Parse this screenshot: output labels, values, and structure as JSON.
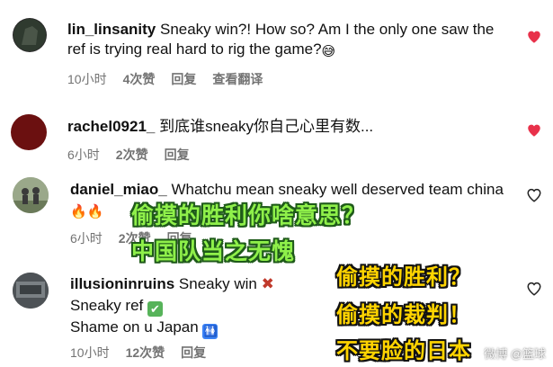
{
  "comments": [
    {
      "username": "lin_linsanity",
      "text_lines": [
        "Sneaky win?! How so? Am I the only one saw the",
        "ref is trying real hard to rig the game?"
      ],
      "time": "10小时",
      "likes": "4次赞",
      "reply": "回复",
      "translate": "查看翻译",
      "liked": true
    },
    {
      "username": "rachel0921_",
      "text_lines": [
        "到底谁sneaky你自己心里有数..."
      ],
      "time": "6小时",
      "likes": "2次赞",
      "reply": "回复",
      "liked": true
    },
    {
      "username": "daniel_miao_",
      "text_lines": [
        "Whatchu mean sneaky well deserved team china",
        ""
      ],
      "time": "6小时",
      "likes": "2次赞",
      "reply": "回复",
      "liked": false
    },
    {
      "username": "illusioninruins",
      "text_lines": [
        "Sneaky win",
        "Sneaky ref",
        "Shame on u Japan"
      ],
      "time": "10小时",
      "likes": "12次赞",
      "reply": "回复",
      "liked": false
    }
  ],
  "overlays": {
    "green_line1": "偷摸的胜利你啥意思？",
    "green_line2": "中国队当之无愧",
    "yellow_line1": "偷摸的胜利？",
    "yellow_line2": "偷摸的裁判！",
    "yellow_line3": "不要脸的日本"
  },
  "watermark": "微博 @篮球",
  "colors": {
    "heart_liked": "#e8314a",
    "meta_gray": "#737373",
    "overlay_green": "#8ff04a",
    "overlay_yellow": "#ffd400"
  },
  "icons": [
    "heart-icon",
    "heart-outline-icon",
    "fire-icon",
    "cross-mark-icon",
    "check-mark-icon",
    "restroom-icon",
    "sweat-smile-icon"
  ]
}
